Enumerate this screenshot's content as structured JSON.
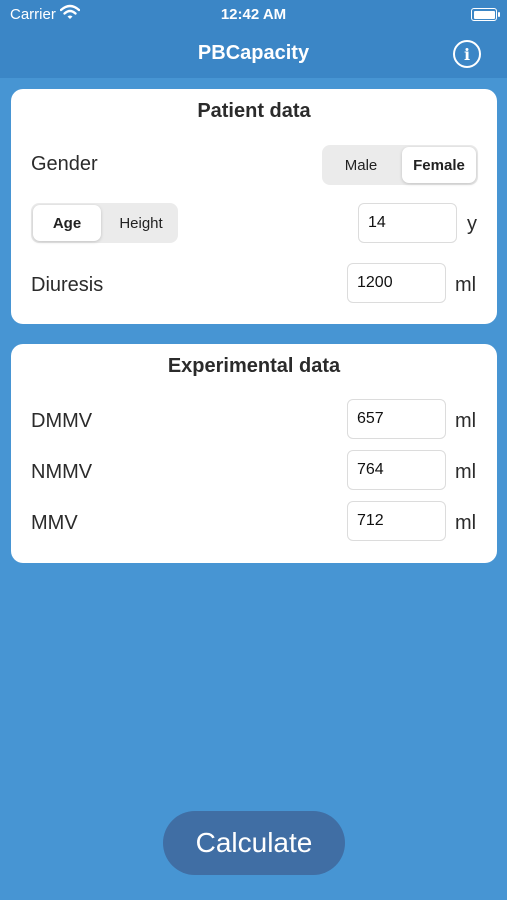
{
  "status_bar": {
    "carrier": "Carrier",
    "time": "12:42 AM",
    "wifi_icon": "wifi-icon",
    "battery_icon": "battery-icon"
  },
  "nav": {
    "title": "PBCapacity",
    "info_icon": "info-icon",
    "info_glyph": "i"
  },
  "patient": {
    "title": "Patient data",
    "gender_label": "Gender",
    "gender_options": [
      "Male",
      "Female"
    ],
    "gender_selected": "Female",
    "measure_options": [
      "Age",
      "Height"
    ],
    "measure_selected": "Age",
    "measure_value": "14",
    "measure_unit": "y",
    "diuresis_label": "Diuresis",
    "diuresis_value": "1200",
    "diuresis_unit": "ml"
  },
  "experimental": {
    "title": "Experimental data",
    "rows": [
      {
        "label": "DMMV",
        "value": "657",
        "unit": "ml"
      },
      {
        "label": "NMMV",
        "value": "764",
        "unit": "ml"
      },
      {
        "label": "MMV",
        "value": "712",
        "unit": "ml"
      }
    ]
  },
  "calculate_label": "Calculate",
  "colors": {
    "background": "#4795d3",
    "bar": "#3b86c6",
    "button": "#406ea4"
  }
}
